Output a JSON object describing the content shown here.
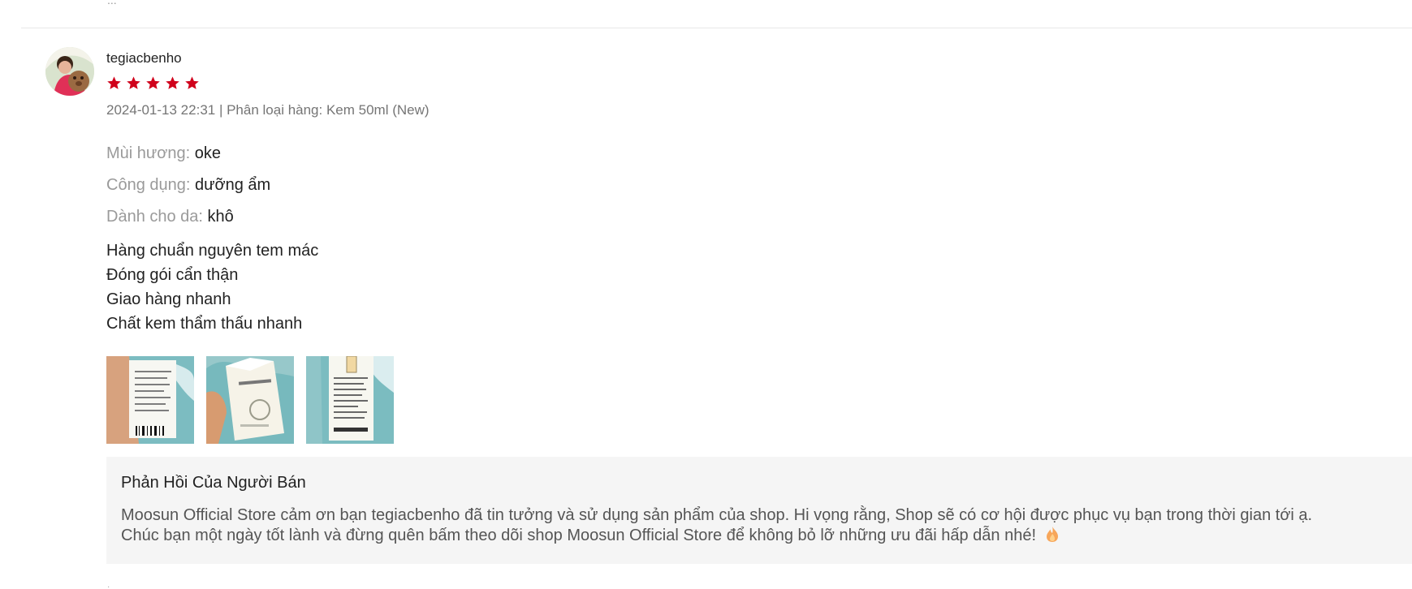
{
  "review": {
    "username": "tegiacbenho",
    "rating": 5,
    "rating_color": "#d0011b",
    "meta_text": "2024-01-13 22:31 | Phân loại hàng: Kem 50ml (New)",
    "attributes": [
      {
        "key": "Mùi hương:",
        "value": "oke"
      },
      {
        "key": "Công dụng:",
        "value": "dưỡng ẩm"
      },
      {
        "key": "Dành cho da:",
        "value": "khô"
      }
    ],
    "comment_lines": [
      "Hàng chuẩn nguyên tem mác",
      "Đóng gói cẩn thận",
      "Giao hàng nhanh",
      "Chất kem thẩm thấu nhanh"
    ],
    "media": [
      {
        "icon": "review-photo-1"
      },
      {
        "icon": "review-photo-2"
      },
      {
        "icon": "review-photo-3"
      }
    ],
    "seller_reply": {
      "title": "Phản Hồi Của Người Bán",
      "lines": [
        "Moosun Official Store cảm ơn bạn tegiacbenho đã tin tưởng và sử dụng sản phẩm của shop. Hi vọng rằng, Shop sẽ có cơ hội được phục vụ bạn trong thời gian tới ạ.",
        "Chúc bạn một ngày tốt lành và đừng quên bấm theo dõi shop Moosun Official Store để không bỏ lỡ những ưu đãi hấp dẫn nhé!"
      ],
      "emoji": "fire-icon"
    }
  },
  "colors": {
    "star": "#d0011b",
    "reply_background": "#f5f5f5",
    "divider": "#e8e8e8"
  }
}
